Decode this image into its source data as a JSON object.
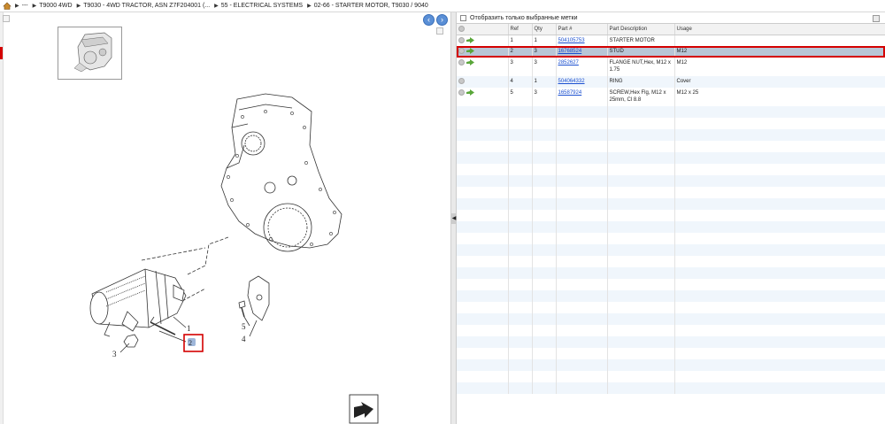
{
  "breadcrumb": {
    "items": [
      "---",
      "T9000 4WD",
      "T9030 - 4WD TRACTOR, ASN Z7F204001 (...",
      "55 - ELECTRICAL SYSTEMS",
      "02-66 - STARTER MOTOR,  T9030 / 9040"
    ]
  },
  "diagram": {
    "callouts": [
      "1",
      "2",
      "3",
      "4",
      "5"
    ],
    "selected_ref": "2"
  },
  "filter": {
    "label": "Отобразить только выбранные метки"
  },
  "table": {
    "columns": [
      "Ref",
      "Qty",
      "Part #",
      "Part Description",
      "Usage"
    ],
    "rows": [
      {
        "ref": "1",
        "qty": "1",
        "part": "504105753",
        "desc": "STARTER MOTOR",
        "usage": "",
        "arrow": true
      },
      {
        "ref": "2",
        "qty": "3",
        "part": "16768524",
        "desc": "STUD",
        "usage": "M12",
        "arrow": true,
        "selected": true
      },
      {
        "ref": "3",
        "qty": "3",
        "part": "2852627",
        "desc": "FLANGE NUT,Hex, M12 x 1.75",
        "usage": "M12",
        "arrow": true
      },
      {
        "ref": "4",
        "qty": "1",
        "part": "504064332",
        "desc": "RING",
        "usage": "Cover",
        "arrow": false
      },
      {
        "ref": "5",
        "qty": "3",
        "part": "16587924",
        "desc": "SCREW,Hex Flg, M12 x 25mm, Cl 8.8",
        "usage": "M12 x 25",
        "arrow": true
      }
    ]
  },
  "colors": {
    "selection_border": "#d40000",
    "link": "#1a4fd0",
    "row_alt": "#f0f6fc"
  }
}
